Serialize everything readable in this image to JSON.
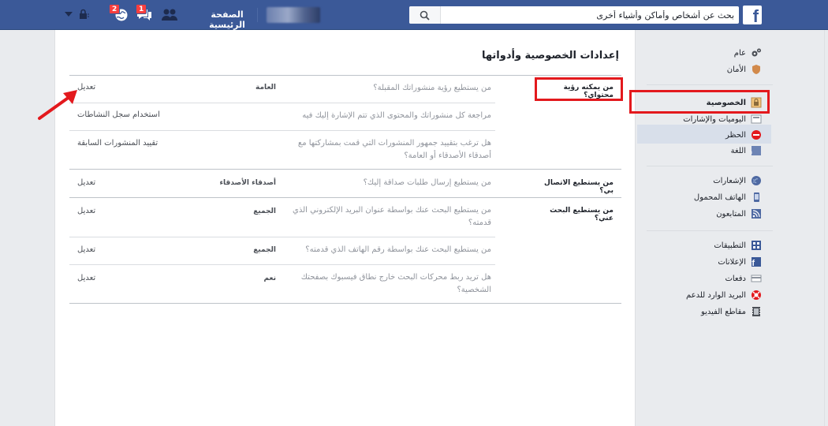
{
  "colors": {
    "brand_blue": "#3b5998",
    "highlight_red": "#e3191d",
    "selected_bg": "#d8dfea",
    "badge_red": "#fa3e3e"
  },
  "topbar": {
    "logo_icon": "facebook-f-icon",
    "search_placeholder": "بحث عن أشخاص وأماكن وأشياء أخرى",
    "search_icon": "search-icon",
    "home_label": "الصفحة الرئيسية",
    "friends_icon": "friends-icon",
    "messages_icon": "messages-icon",
    "messages_badge": "1",
    "notifications_icon": "globe-icon",
    "notifications_badge": "2",
    "privacy_shortcut_icon": "lock-icon",
    "menu_icon": "caret-down-icon"
  },
  "page": {
    "title": "إعدادات الخصوصية وأدواتها",
    "sections": [
      {
        "label": "من يمكنه رؤية محتواي؟",
        "rows": [
          {
            "question": "من يستطيع رؤية منشوراتك المقبلة؟",
            "value": "العامة",
            "action": "تعديل"
          },
          {
            "question": "مراجعة كل منشوراتك والمحتوى الذي تتم الإشارة إليك فيه",
            "value": "",
            "action": "استخدام سجل النشاطات"
          },
          {
            "question": "هل ترغب بتقييد جمهور المنشورات التي قمت بمشاركتها مع أصدقاء الأصدقاء أو العامة؟",
            "value": "",
            "action": "تقييد المنشورات السابقة"
          }
        ]
      },
      {
        "label": "من يستطيع الاتصال بي؟",
        "rows": [
          {
            "question": "من يستطيع إرسال طلبات صداقة إليك؟",
            "value": "أصدقاء الأصدقاء",
            "action": "تعديل"
          }
        ]
      },
      {
        "label": "من يستطيع البحث عني؟",
        "rows": [
          {
            "question": "من يستطيع البحث عنك بواسطة عنوان البريد الإلكتروني الذي قدمته؟",
            "value": "الجميع",
            "action": "تعديل"
          },
          {
            "question": "من يستطيع البحث عنك بواسطة رقم الهاتف الذي قدمته؟",
            "value": "الجميع",
            "action": "تعديل"
          },
          {
            "question": "هل تريد ربط محركات البحث خارج نطاق فيسبوك بصفحتك الشخصية؟",
            "value": "نعم",
            "action": "تعديل"
          }
        ]
      }
    ]
  },
  "sidebar": {
    "groups": [
      [
        {
          "label": "عام",
          "icon": "gears-icon"
        },
        {
          "label": "الأمان",
          "icon": "shield-icon"
        }
      ],
      [
        {
          "label": "الخصوصية",
          "icon": "padlock-icon",
          "selected": true
        },
        {
          "label": "اليوميات والإشارات",
          "icon": "timeline-icon"
        },
        {
          "label": "الحظر",
          "icon": "block-icon"
        },
        {
          "label": "اللغة",
          "icon": "language-icon"
        }
      ],
      [
        {
          "label": "الإشعارات",
          "icon": "globe-icon"
        },
        {
          "label": "الهاتف المحمول",
          "icon": "mobile-icon"
        },
        {
          "label": "المتابعون",
          "icon": "rss-icon"
        }
      ],
      [
        {
          "label": "التطبيقات",
          "icon": "apps-icon"
        },
        {
          "label": "الإعلانات",
          "icon": "ads-icon"
        },
        {
          "label": "دفعات",
          "icon": "payments-icon"
        },
        {
          "label": "البريد الوارد للدعم",
          "icon": "support-icon"
        },
        {
          "label": "مقاطع الفيديو",
          "icon": "video-icon"
        }
      ]
    ]
  }
}
